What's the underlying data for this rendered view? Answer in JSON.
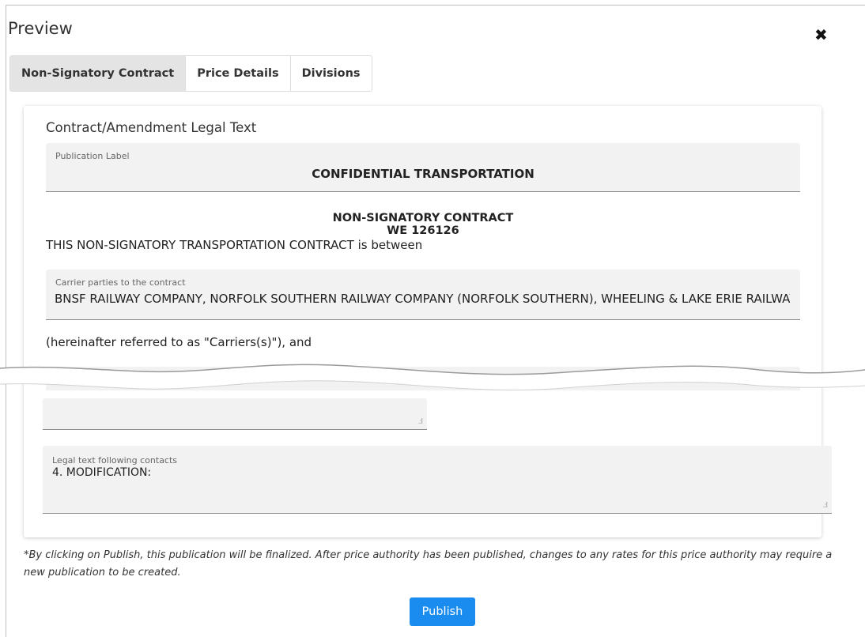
{
  "dialog": {
    "title": "Preview",
    "close_icon": "close-icon"
  },
  "tabs": [
    {
      "label": "Non-Signatory Contract",
      "active": true
    },
    {
      "label": "Price Details",
      "active": false
    },
    {
      "label": "Divisions",
      "active": false
    }
  ],
  "contract": {
    "heading": "Contract/Amendment Legal Text",
    "publication_label": {
      "label": "Publication Label",
      "value": "CONFIDENTIAL TRANSPORTATION"
    },
    "title_line1": "NON-SIGNATORY CONTRACT",
    "title_line2": "WE 126126",
    "intro": "THIS NON-SIGNATORY TRANSPORTATION CONTRACT is between",
    "carrier_parties": {
      "label": "Carrier parties to the contract",
      "value": "BNSF RAILWAY COMPANY, NORFOLK SOUTHERN RAILWAY COMPANY (NORFOLK SOUTHERN), WHEELING & LAKE ERIE RAILWAY"
    },
    "hereinafter": "(hereinafter referred to as \"Carriers(s)\"), and",
    "legal_following": {
      "label": "Legal text following contacts",
      "value": "4.  MODIFICATION:"
    }
  },
  "note": "*By clicking on Publish, this publication will be finalized. After price authority has been published, changes to any rates for this price authority may require a new publication to be created.",
  "publish_label": "Publish",
  "colors": {
    "publish_button": "#1a8cf0",
    "active_tab": "#e4e4e4",
    "field_bg": "#f2f2f2"
  }
}
